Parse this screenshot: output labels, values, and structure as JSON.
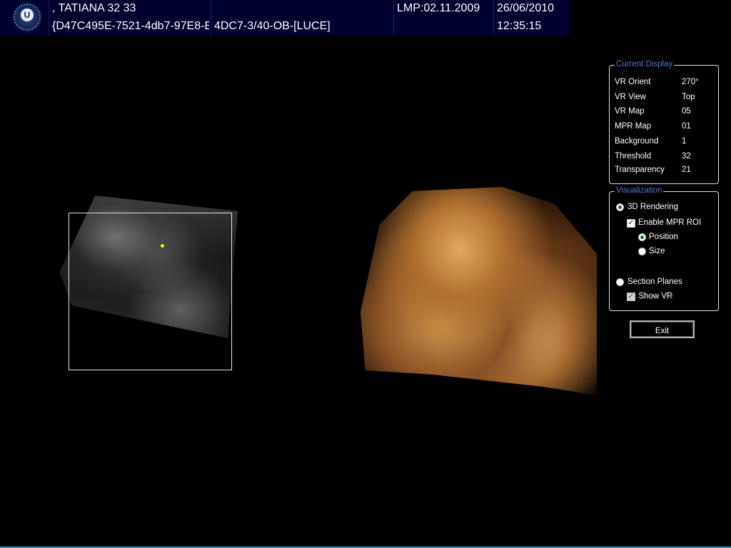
{
  "header": {
    "patient_name": ", TATIANA 32 33",
    "study_id": "{D47C495E-7521-4db7-97E8-E",
    "probe_preset": "4DC7-3/40-OB-[LUCE]",
    "lmp": "LMP:02.11.2009",
    "date": "26/06/2010",
    "time": "12:35:15",
    "logo_letter": "U"
  },
  "current_display": {
    "title": "Current Display",
    "rows": [
      {
        "label": "VR Orient",
        "value": "270°"
      },
      {
        "label": "VR View",
        "value": "Top"
      },
      {
        "label": "VR Map",
        "value": "05"
      },
      {
        "label": "MPR Map",
        "value": "01"
      },
      {
        "label": "Background",
        "value": "1"
      },
      {
        "label": "Threshold",
        "value": "32"
      },
      {
        "label": "Transparency",
        "value": "21"
      }
    ]
  },
  "visualization": {
    "title": "Visualization",
    "rendering_3d": {
      "label": "3D Rendering",
      "selected": true
    },
    "enable_mpr_roi": {
      "label": "Enable MPR ROI",
      "checked": true
    },
    "position": {
      "label": "Position",
      "selected": true
    },
    "size": {
      "label": "Size",
      "selected": false
    },
    "section_planes": {
      "label": "Section Planes",
      "selected": false
    },
    "show_vr": {
      "label": "Show VR",
      "checked": true,
      "enabled": false
    }
  },
  "exit_button": {
    "label": "Exit"
  },
  "colors": {
    "header_bg": "#00002e",
    "panel_title": "#5678c8",
    "marker": "#f5f200",
    "bottom_accent": "#2a9ad6"
  },
  "icons": {
    "logo": "ultrasound-logo-icon",
    "marker": "roi-marker-icon"
  }
}
